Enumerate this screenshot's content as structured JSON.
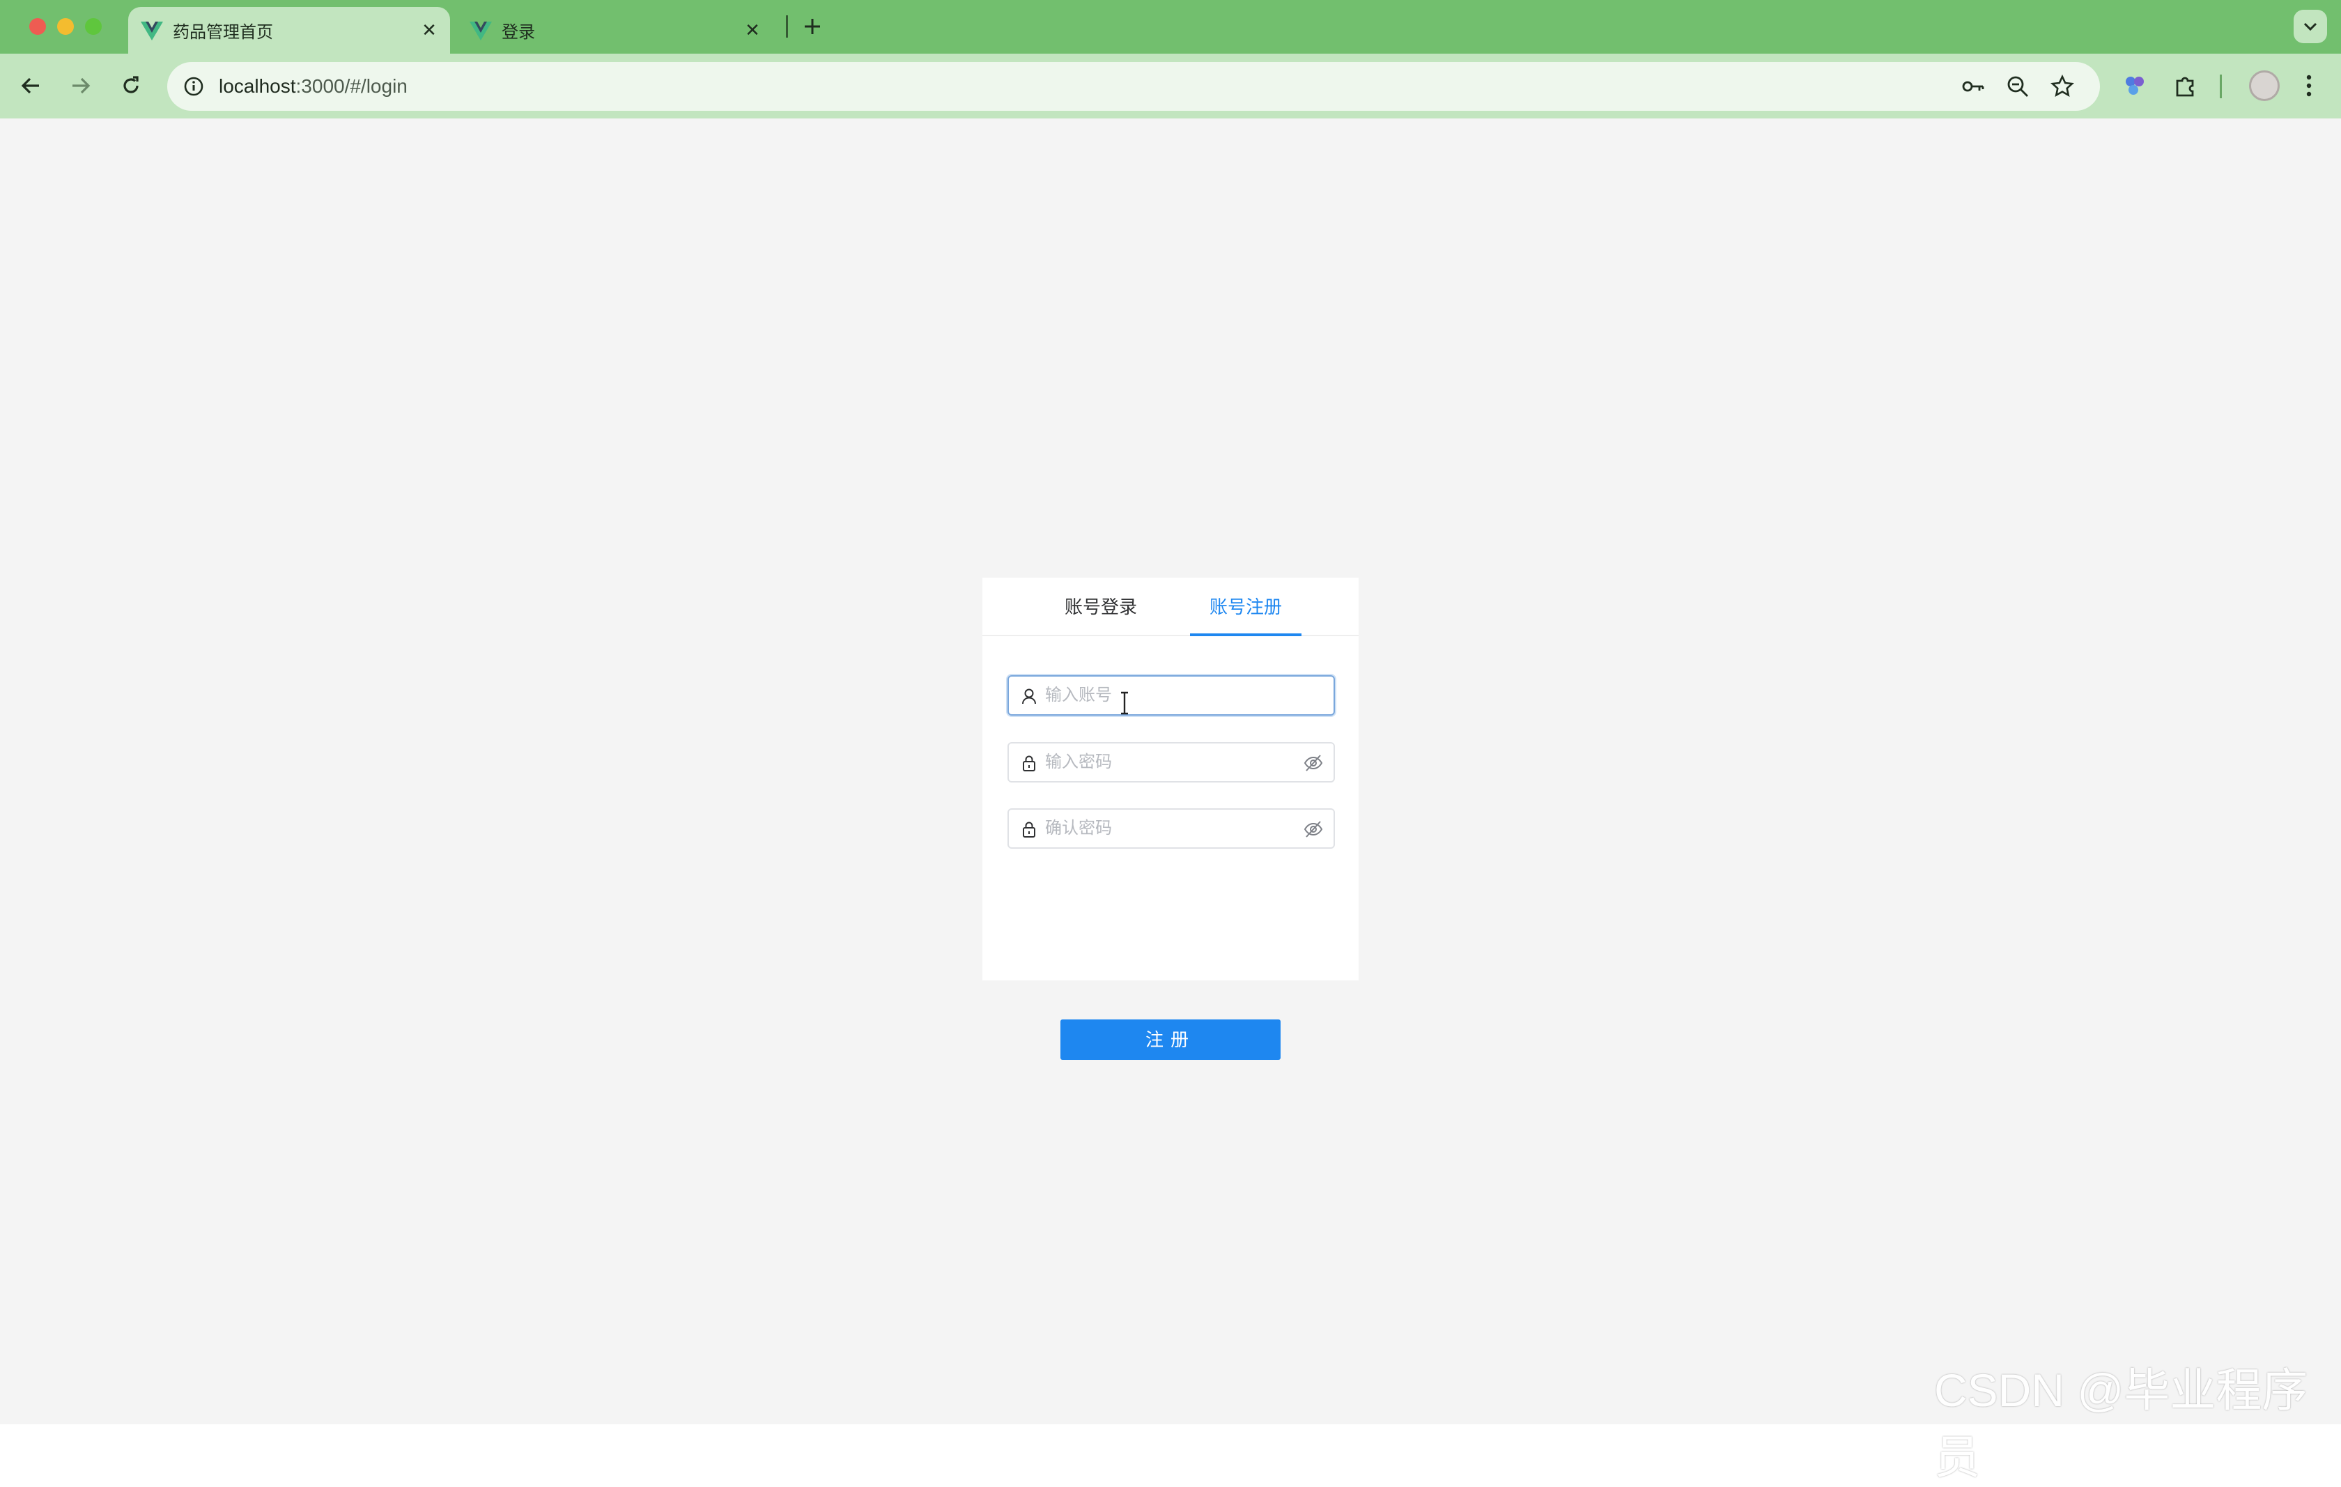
{
  "browser": {
    "tabs": [
      {
        "title": "药品管理首页",
        "active": true
      },
      {
        "title": "登录",
        "active": false
      }
    ],
    "url_host": "localhost",
    "url_rest": ":3000/#/login",
    "colors": {
      "frame": "#72bf6e",
      "toolbar": "#c2e5bf"
    }
  },
  "auth_card": {
    "tabs": {
      "login": "账号登录",
      "register": "账号注册",
      "active": "register"
    },
    "fields": {
      "account_placeholder": "输入账号",
      "password_placeholder": "输入密码",
      "confirm_placeholder": "确认密码"
    },
    "submit_label": "注册",
    "accent": "#1e87f0"
  },
  "watermark": "CSDN @毕业程序员"
}
